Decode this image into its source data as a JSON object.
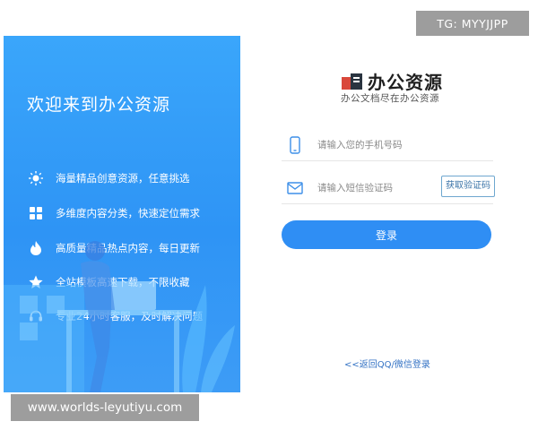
{
  "left_panel": {
    "welcome": "欢迎来到办公资源",
    "features": [
      {
        "icon": "lightbulb-icon",
        "text": "海量精品创意资源，任意挑选"
      },
      {
        "icon": "grid-icon",
        "text": "多维度内容分类，快速定位需求"
      },
      {
        "icon": "flame-icon",
        "text": "高质量精品热点内容，每日更新"
      },
      {
        "icon": "star-icon",
        "text": "全站模板高速下载，不限收藏"
      },
      {
        "icon": "headset-icon",
        "text": "专业24小时客服，及时解决问题"
      }
    ]
  },
  "brand": {
    "title": "办公资源",
    "slogan": "办公文档尽在办公资源"
  },
  "form": {
    "phone_placeholder": "请输入您的手机号码",
    "code_placeholder": "请输入短信验证码",
    "get_code_label": "获取验证码",
    "login_label": "登录",
    "back_link": "<<返回QQ/微信登录"
  },
  "watermarks": {
    "tg": "TG: MYYJJPP",
    "url": "www.worlds-leyutiyu.com"
  },
  "colors": {
    "panel_blue": "#2e94f5",
    "button_blue": "#2f8ef4",
    "link_blue": "#3372c4"
  }
}
